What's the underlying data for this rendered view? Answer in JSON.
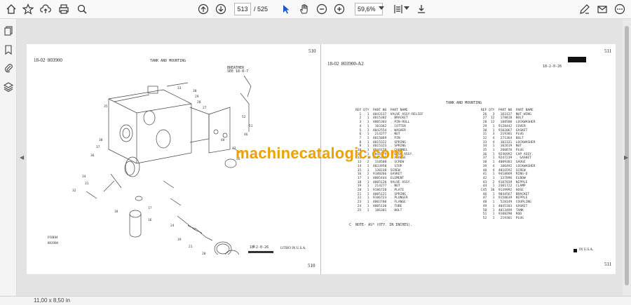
{
  "toolbar": {
    "current_page": "513",
    "page_separator": "/",
    "total_pages": "525",
    "zoom": "59,6%",
    "icons": [
      "home-icon",
      "bookmark-star-icon",
      "cloud-upload-icon",
      "print-icon",
      "zoom-magnifier-icon",
      "page-up-icon",
      "page-down-icon",
      "select-arrow-icon",
      "hand-icon",
      "zoom-out-icon",
      "zoom-in-icon",
      "fit-page-icon",
      "save-icon",
      "sign-pen-icon",
      "mail-icon",
      "more-icon"
    ]
  },
  "status": {
    "page_size": "11,00 x 8,50 in"
  },
  "left_page": {
    "header_section": "18-02",
    "header_code": "803900",
    "page_number": "510",
    "title": "TANK AND MOUNTING",
    "form_label": "FORM",
    "form_number": "803900",
    "revision": "18-2-0-26",
    "litho": "LITHO IN U.S.A.",
    "breather_label": "BREATHER\nSEE 18-8-7",
    "footer_page": "510"
  },
  "right_page": {
    "header_section": "18-02",
    "header_code": "803900-A2",
    "page_number": "511",
    "revision": "18-2-0-26",
    "title": "TANK AND MOUNTING",
    "footnote": "C  NOTE- AS* (OTY. IN INCHES).",
    "litho": "IN U.S.A.",
    "footer_page": "511",
    "columns": [
      "REF",
      "QTY",
      "PART NO",
      "PART NAME"
    ],
    "left_rows": [
      "  1   1  4043137  VALVE ASSY-RELIEF",
      "  2   1  4015302  . BRACKET",
      "  3   1  4005303  . PIN-ROLL",
      "  4   1   103362  . COTTER",
      "  5   1  4042554  . WASHER",
      "  6   1   214277  . NUT",
      "  7   1  4015069  . PIN",
      "  8   1  4015322  . SPRING",
      "  9   1  4015323  . SPRING",
      " 10   1  4044178  . CHANNEL",
      " 11   1  4044179  . DISC ASSY.",
      " 12   1  4015495  . FLANGE",
      " 13   2   110508  . SCREW",
      " 14   1  4033958  . STOP",
      " 15   1   138338  SCREW",
      " 16   2  9188266  GASKET",
      " 17   1  4005444  ELEMENT",
      " 18   1  4005120  VALVE ASSY.",
      " 19   1   214277  . NUT",
      " 20   1  9186728  . PLATE",
      " 21   1  4005121  . SPRING",
      " 22   1  9186723  . PLUNGER",
      " 23   1  4003780  . FLANGE",
      " 24   1  4005130  . TUBE",
      " 25   1   186301  . BOLT"
    ],
    "right_rows": [
      " 26   3   103127  NUT-WING",
      " 27  12   178818  BOLT",
      " 28  12   108580  LOCKWASHER",
      " 29   1  9128442  COVER",
      " 30   1  9102067  GASKET",
      " 31   3   219301  PLUG",
      " 32   4   271364  BOLT",
      " 33   4   102331  LOCKWASHER",
      " 34   1   102619  NUT",
      " 35   1   200878  PLUG",
      " 36   1  9246992  CAP ASSY.",
      " 37   1  9247239  . GASKET",
      " 38   1  4009383  GAUGE",
      " 39   4   106492  LOCKWASHER",
      " 40   4  4016592  SCREW",
      " 41   1  9418869  RING-O",
      " 42   1   137896  ELBOW",
      " 43   2  9107039  NIPPLE",
      " 44   1  2301722  CLAMP",
      "C45  36  9139992  HOSE",
      " 46   1  9044567  BRACKET",
      " 47   1  9158639  NIPPLE",
      " 48   1   528149  COUPLING",
      " 49   1  4045103  GASKET",
      " 50   1  4013499  TANK",
      " 51   1  9188290  ROD",
      " 52   1   219301  PLUG"
    ]
  },
  "watermark": "machinecatalogic.com"
}
